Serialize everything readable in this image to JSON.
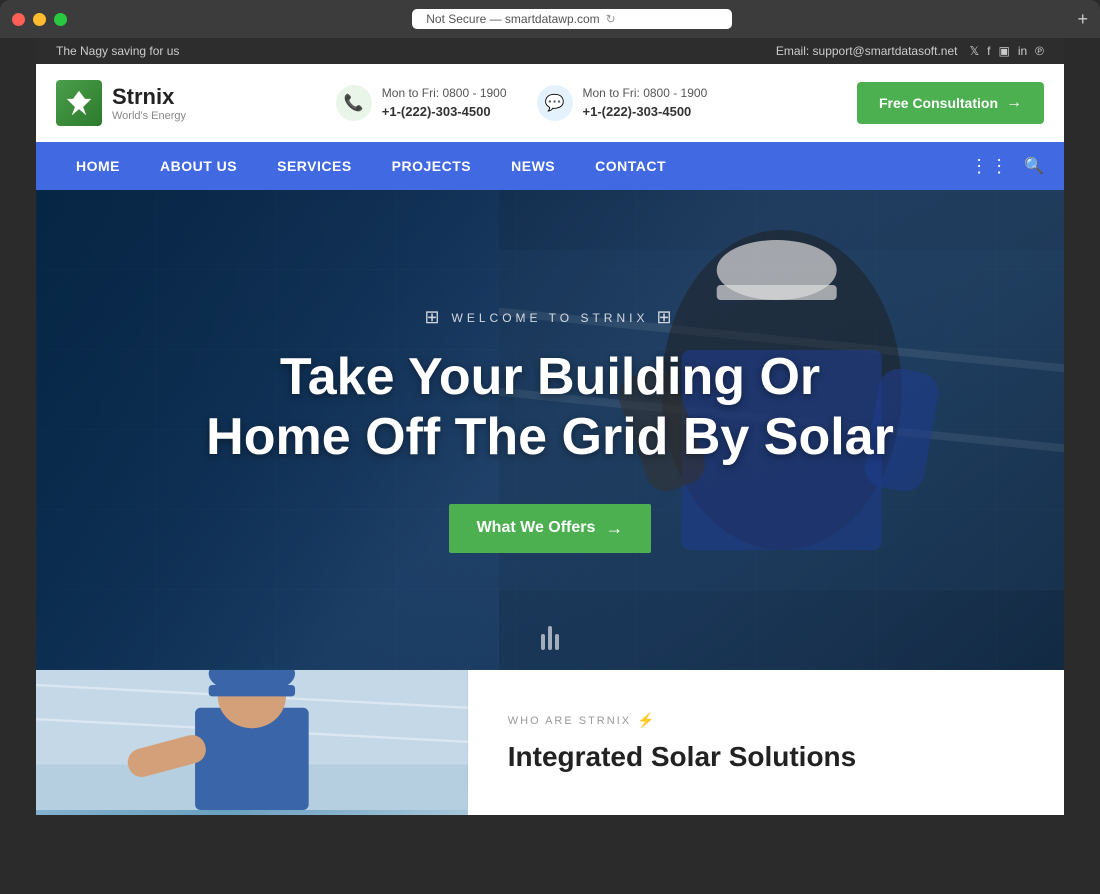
{
  "window": {
    "address": "Not Secure — smartdatawp.com",
    "traffic_lights": [
      "red",
      "yellow",
      "green"
    ]
  },
  "topbar": {
    "left_text": "The Nagy saving for us",
    "email_label": "Email: support@smartdatasoft.net",
    "social_icons": [
      "𝕏",
      "f",
      "📷",
      "in",
      "📌"
    ]
  },
  "header": {
    "logo_name": "Strnix",
    "logo_tagline": "World's Energy",
    "logo_icon": "⚡",
    "contact1": {
      "icon": "📞",
      "line1": "Mon to Fri: 0800 - 1900",
      "line2": "+1-(222)-303-4500"
    },
    "contact2": {
      "icon": "💬",
      "line1": "Mon to Fri: 0800 - 1900",
      "line2": "+1-(222)-303-4500"
    },
    "cta_label": "Free Consultation",
    "cta_arrow": "→"
  },
  "nav": {
    "items": [
      {
        "label": "HOME",
        "active": true
      },
      {
        "label": "ABOUT US",
        "active": false
      },
      {
        "label": "SERVICES",
        "active": false
      },
      {
        "label": "PROJECTS",
        "active": false
      },
      {
        "label": "NEWS",
        "active": false
      },
      {
        "label": "CONTACT",
        "active": false
      }
    ],
    "dots": "⋮",
    "search_icon": "🔍"
  },
  "hero": {
    "label": "WELCOME TO STRNIX",
    "solar_icon_left": "🔆",
    "solar_icon_right": "🔆",
    "title_line1": "Take Your Building Or",
    "title_line2": "Home Off The Grid By Solar",
    "cta_label": "What We Offers",
    "cta_arrow": "→"
  },
  "below_fold": {
    "section_label": "WHO ARE STRNIX",
    "lightning": "⚡",
    "section_title": "Integrated Solar Solutions"
  }
}
